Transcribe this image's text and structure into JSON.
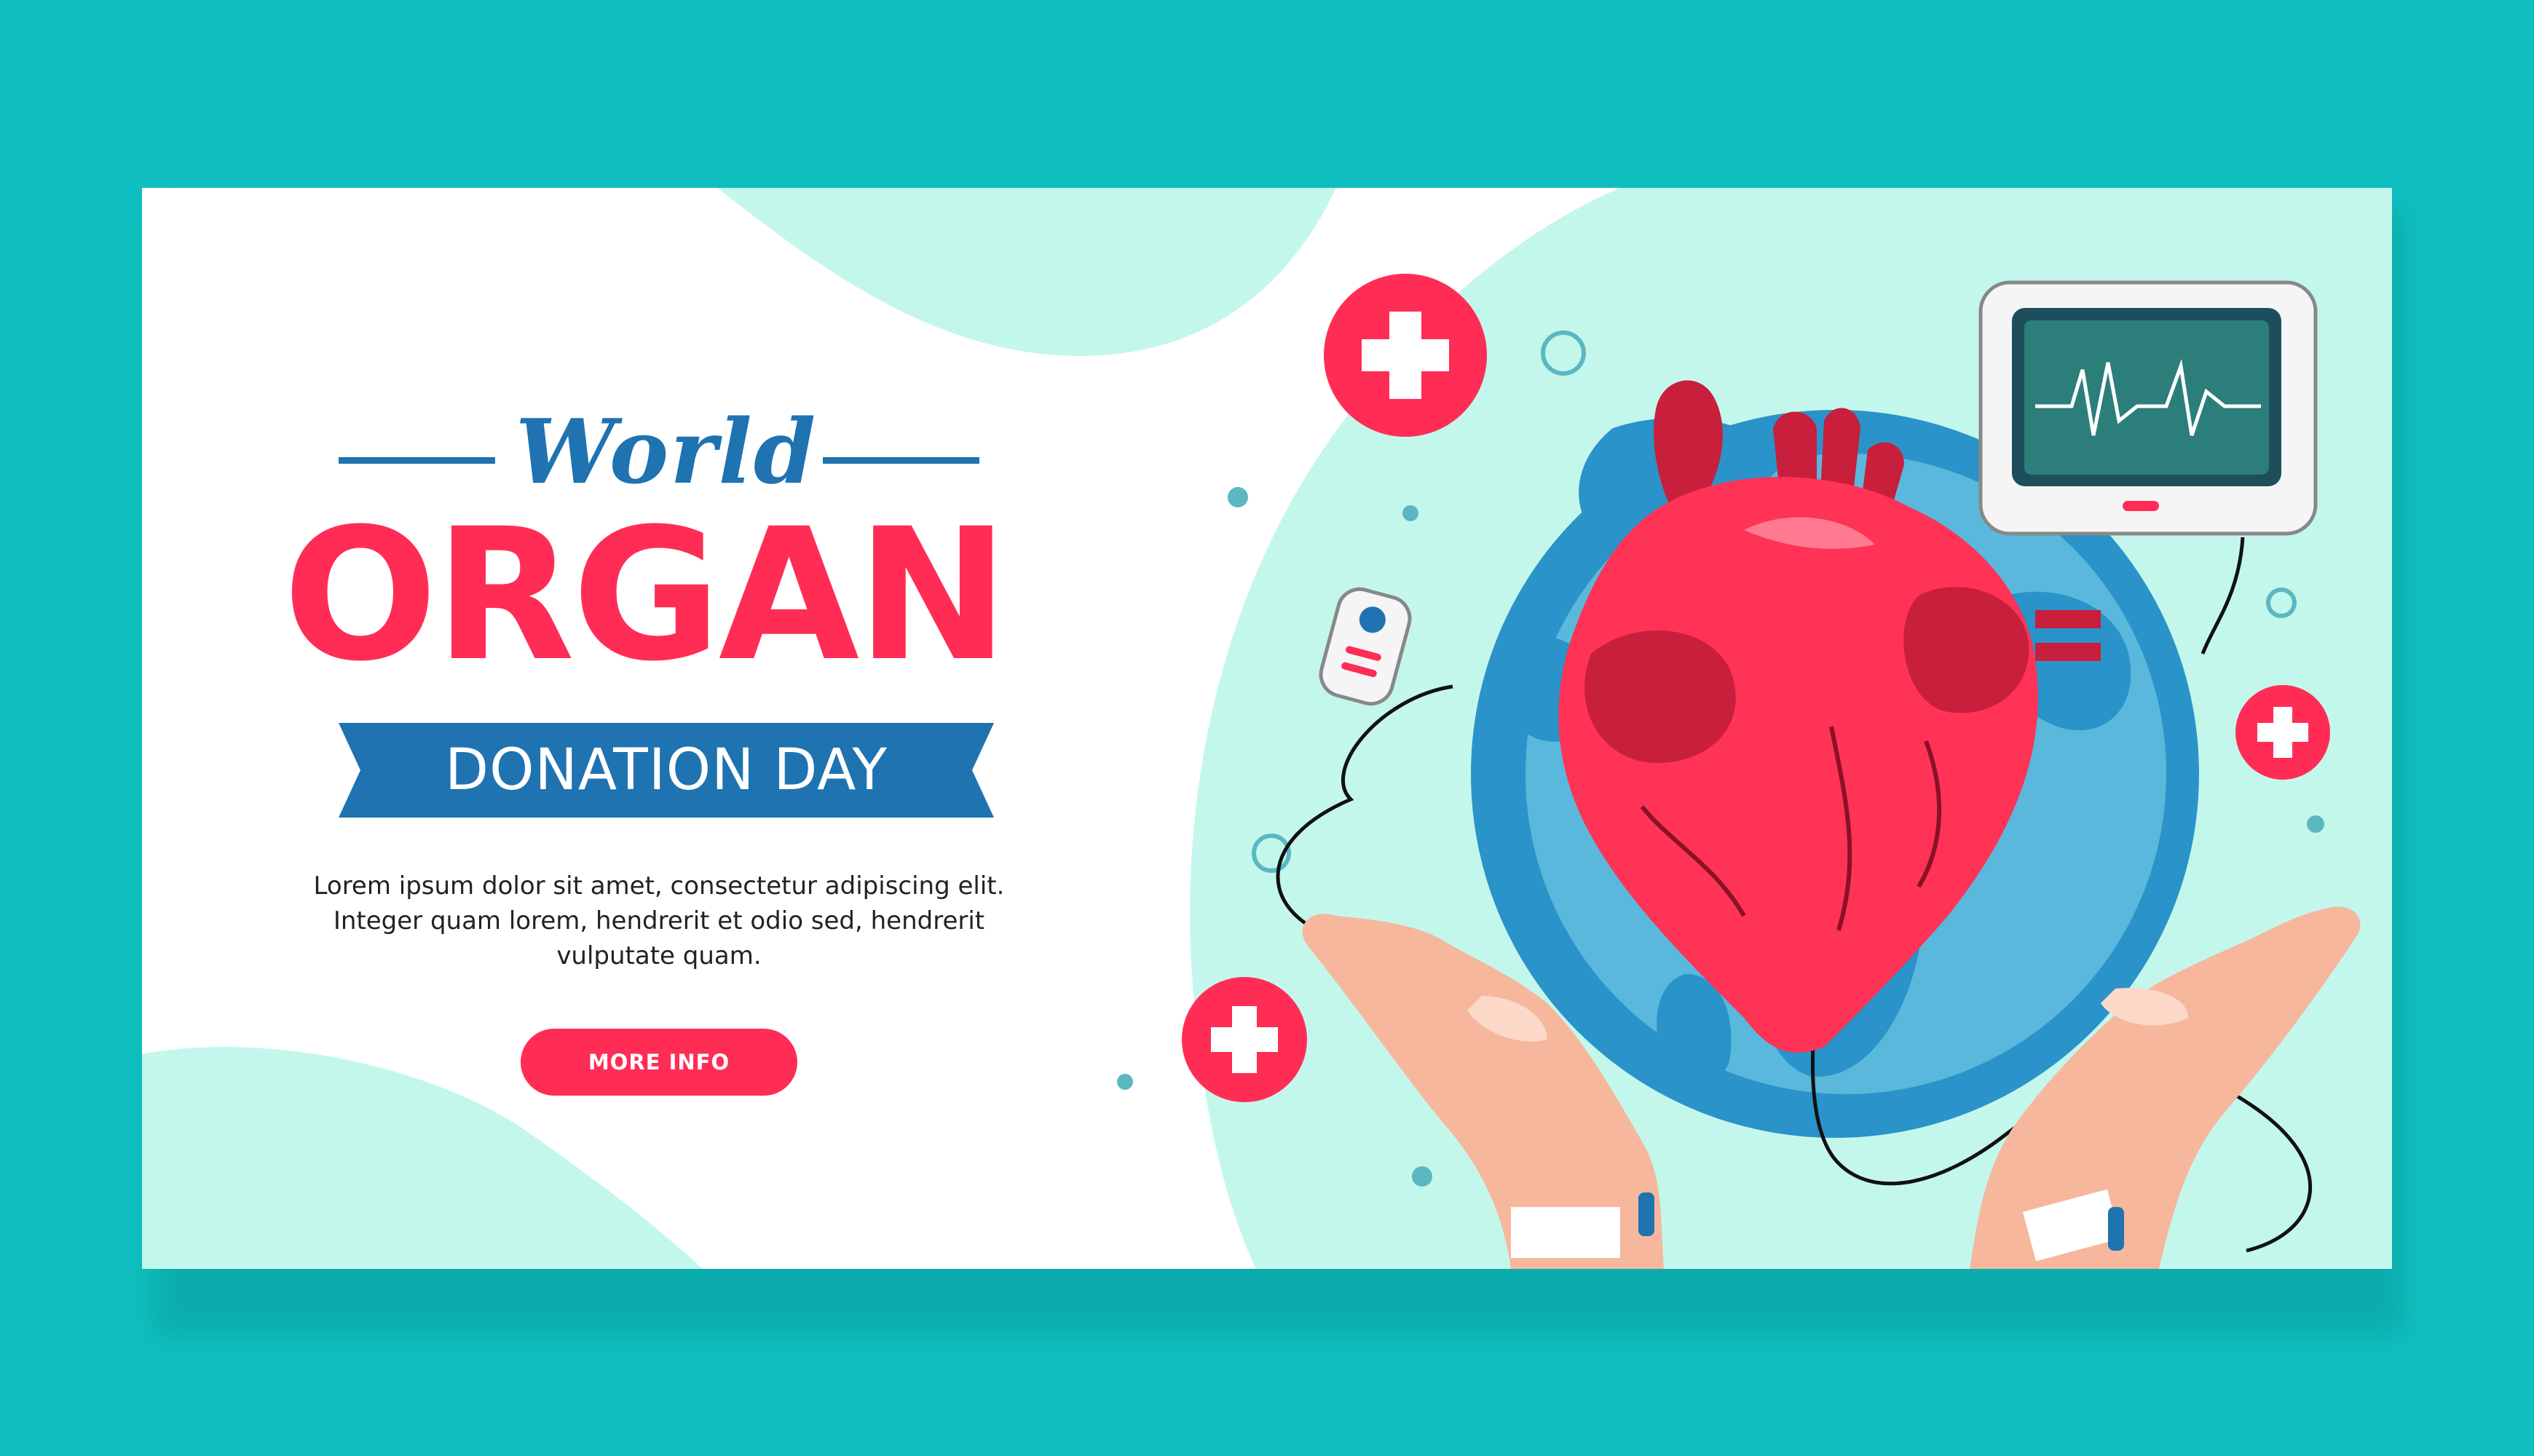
{
  "banner": {
    "world": "World",
    "organ": "ORGAN",
    "ribbon": "DONATION DAY",
    "body_lines": [
      "Lorem ipsum dolor sit amet, consectetur adipiscing elit.",
      "Integer quam lorem, hendrerit et odio sed, hendrerit",
      "vulputate quam."
    ],
    "button_label": "MORE INFO"
  },
  "colors": {
    "page_bg": "#0fbfbf",
    "accent_red": "#ff2d55",
    "accent_blue": "#1e73b0",
    "mint": "#c4f7ec"
  },
  "icons": [
    "medical-cross-icon",
    "heart-illustration",
    "globe-illustration",
    "heart-monitor-illustration",
    "hands-illustration",
    "pulse-oximeter-illustration"
  ]
}
